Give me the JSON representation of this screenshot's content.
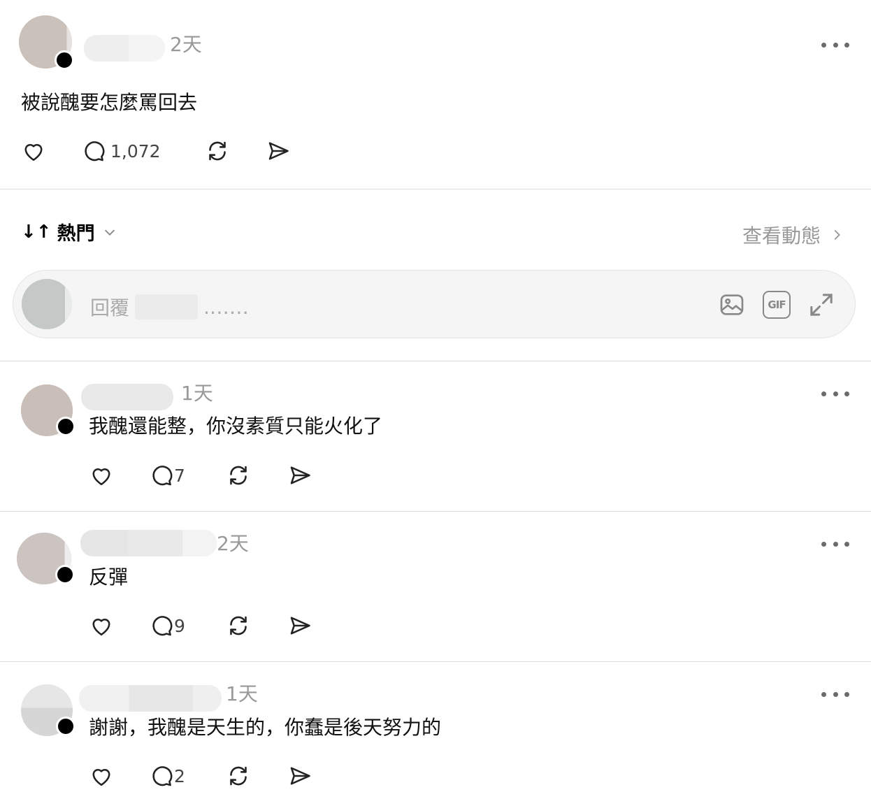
{
  "post": {
    "time": "2天",
    "text": "被說醜要怎麼罵回去",
    "comment_count": "1,072"
  },
  "sort": {
    "arrows": "↓↑",
    "label": "熱門",
    "view_activity": "查看動態"
  },
  "reply": {
    "placeholder_prefix": "回覆",
    "placeholder_suffix": ".……"
  },
  "comments": [
    {
      "time": "1天",
      "text": "我醜還能整，你沒素質只能火化了",
      "count": "7"
    },
    {
      "time": "2天",
      "text": "反彈",
      "count": "9"
    },
    {
      "time": "1天",
      "text": "謝謝，我醜是天生的，你蠢是後天努力的",
      "count": "2"
    }
  ],
  "icons": {
    "like": "heart-icon",
    "comment": "comment-icon",
    "repost": "repost-icon",
    "share": "send-icon",
    "more": "more-icon",
    "image": "image-icon",
    "gif": "gif-icon",
    "expand": "expand-icon",
    "chevron": "chevron-down-icon"
  },
  "colors": {
    "muted": "#999999",
    "divider": "#dcdcdc",
    "reply_bg": "#f5f5f5"
  }
}
